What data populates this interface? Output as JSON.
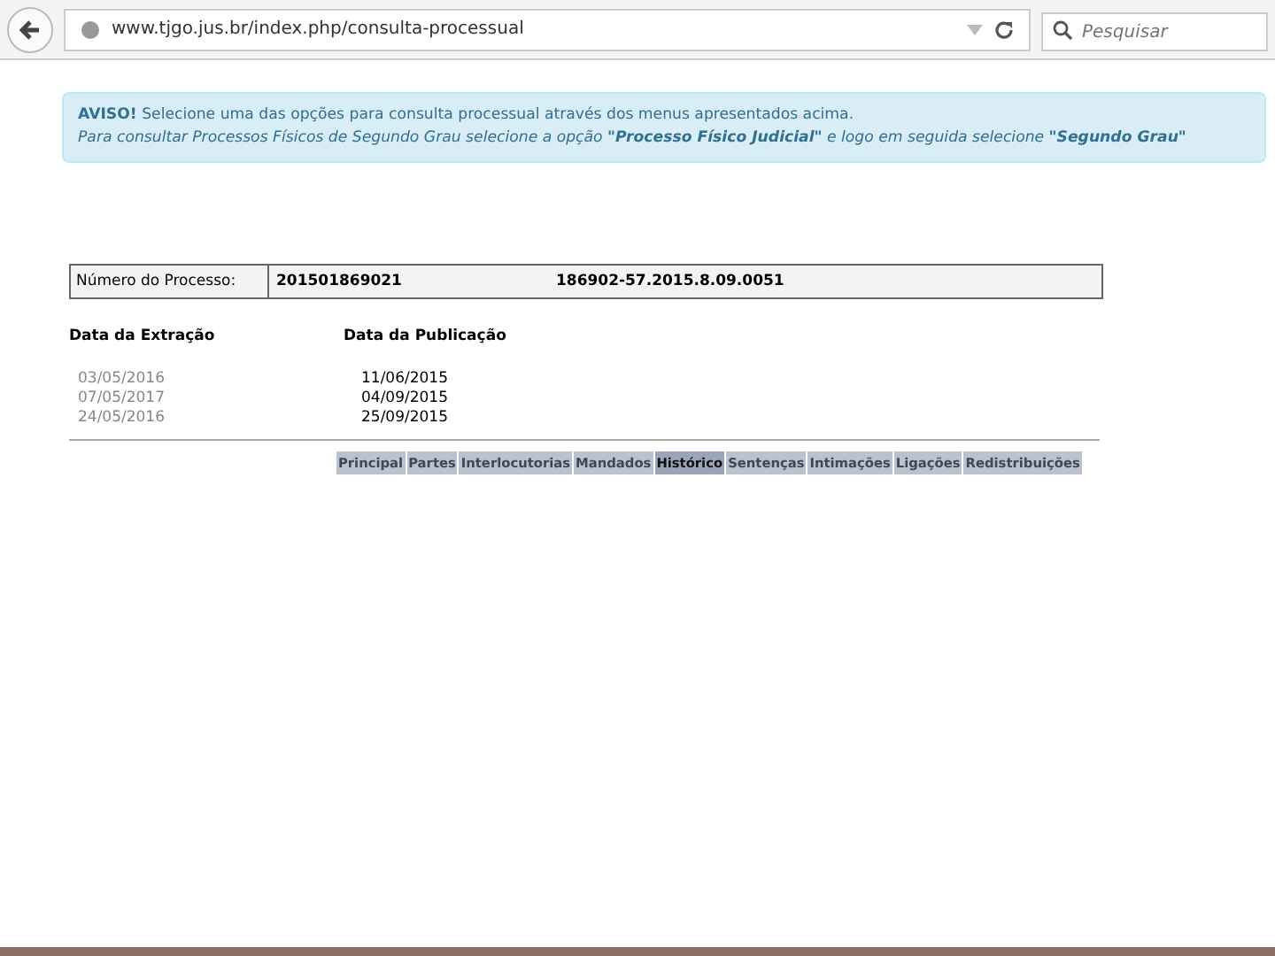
{
  "browser": {
    "url": "www.tjgo.jus.br/index.php/consulta-processual",
    "search_placeholder": "Pesquisar"
  },
  "notice": {
    "title": "AVISO!",
    "line1": "Selecione uma das opções para consulta processual através dos menus apresentados acima.",
    "line2": "Para consultar Processos Físicos de Segundo Grau selecione a opção **\"Processo Físico Judicial\"** e logo em seguida selecione **\"Segundo Grau\"**"
  },
  "process": {
    "label": "Número do Processo:",
    "number": "201501869021",
    "cnj": "186902-57.2015.8.09.0051"
  },
  "dates": {
    "columns": [
      "Data da Extração",
      "Data da Publicação"
    ],
    "rows": [
      [
        "03/05/2016",
        "11/06/2015"
      ],
      [
        "07/05/2017",
        "04/09/2015"
      ],
      [
        "24/05/2016",
        "25/09/2015"
      ]
    ]
  },
  "tabs": [
    {
      "label": "Principal",
      "selected": false
    },
    {
      "label": "Partes",
      "selected": false
    },
    {
      "label": "Interlocutorias",
      "selected": false
    },
    {
      "label": "Mandados",
      "selected": false
    },
    {
      "label": "Histórico",
      "selected": true
    },
    {
      "label": "Sentenças",
      "selected": false
    },
    {
      "label": "Intimações",
      "selected": false
    },
    {
      "label": "Ligações",
      "selected": false
    },
    {
      "label": "Redistribuições",
      "selected": false
    }
  ]
}
